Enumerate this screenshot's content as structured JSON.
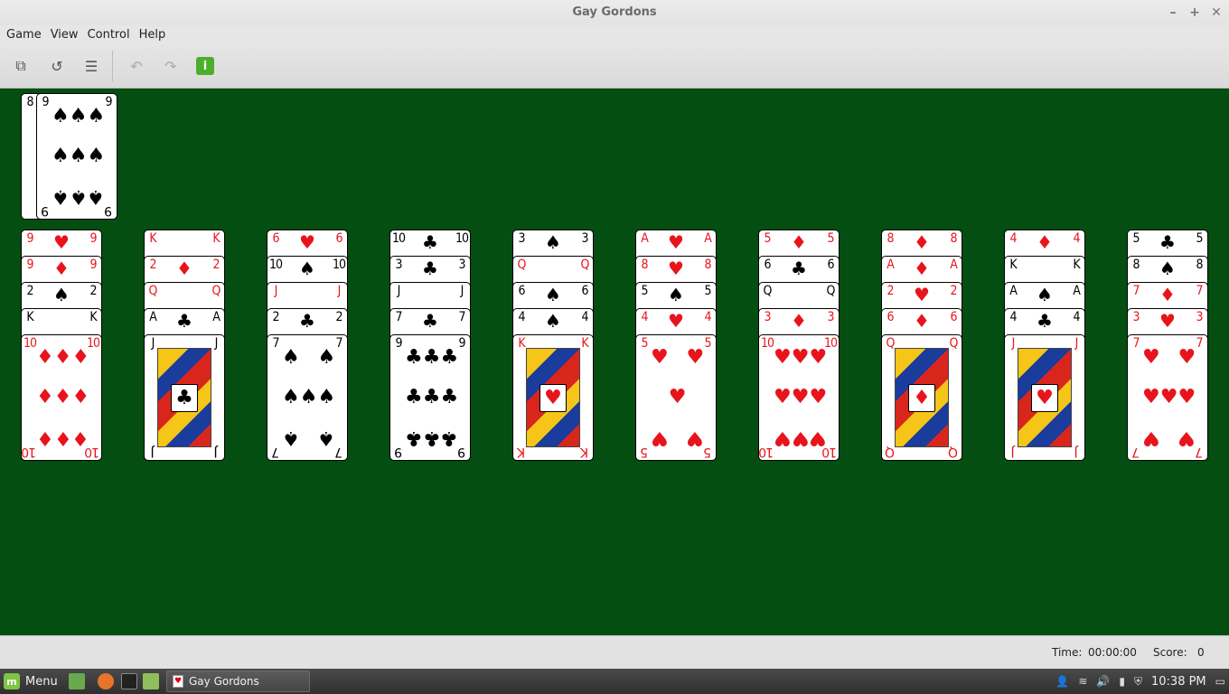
{
  "window": {
    "title": "Gay Gordons",
    "controls": [
      "–",
      "+",
      "✕"
    ]
  },
  "menu": [
    "Game",
    "View",
    "Control",
    "Help"
  ],
  "toolbar": {
    "buttons": [
      {
        "name": "new-game-icon",
        "glyph": "⧉",
        "enabled": true
      },
      {
        "name": "restart-icon",
        "glyph": "↺",
        "enabled": true
      },
      {
        "name": "statistics-icon",
        "glyph": "☰",
        "enabled": true
      },
      {
        "name": "undo-icon",
        "glyph": "↶",
        "enabled": false
      },
      {
        "name": "redo-icon",
        "glyph": "↷",
        "enabled": false
      },
      {
        "name": "info-icon",
        "glyph": "i",
        "enabled": true
      }
    ]
  },
  "reserve": [
    {
      "rank": "8",
      "suit": "clubs"
    },
    {
      "rank": "9",
      "suit": "spades"
    }
  ],
  "tableau": [
    [
      {
        "rank": "9",
        "suit": "hearts"
      },
      {
        "rank": "9",
        "suit": "diamonds"
      },
      {
        "rank": "2",
        "suit": "spades"
      },
      {
        "rank": "K",
        "suit": "spades"
      },
      {
        "rank": "10",
        "suit": "diamonds"
      }
    ],
    [
      {
        "rank": "K",
        "suit": "diamonds"
      },
      {
        "rank": "2",
        "suit": "diamonds"
      },
      {
        "rank": "Q",
        "suit": "diamonds"
      },
      {
        "rank": "A",
        "suit": "clubs"
      },
      {
        "rank": "J",
        "suit": "clubs"
      }
    ],
    [
      {
        "rank": "6",
        "suit": "hearts"
      },
      {
        "rank": "10",
        "suit": "spades"
      },
      {
        "rank": "J",
        "suit": "hearts"
      },
      {
        "rank": "2",
        "suit": "clubs"
      },
      {
        "rank": "7",
        "suit": "spades"
      }
    ],
    [
      {
        "rank": "10",
        "suit": "clubs"
      },
      {
        "rank": "3",
        "suit": "clubs"
      },
      {
        "rank": "J",
        "suit": "spades"
      },
      {
        "rank": "7",
        "suit": "clubs"
      },
      {
        "rank": "9",
        "suit": "clubs"
      }
    ],
    [
      {
        "rank": "3",
        "suit": "spades"
      },
      {
        "rank": "Q",
        "suit": "hearts"
      },
      {
        "rank": "6",
        "suit": "spades"
      },
      {
        "rank": "4",
        "suit": "spades"
      },
      {
        "rank": "K",
        "suit": "hearts"
      }
    ],
    [
      {
        "rank": "A",
        "suit": "hearts"
      },
      {
        "rank": "8",
        "suit": "hearts"
      },
      {
        "rank": "5",
        "suit": "spades"
      },
      {
        "rank": "4",
        "suit": "hearts"
      },
      {
        "rank": "5",
        "suit": "hearts"
      }
    ],
    [
      {
        "rank": "5",
        "suit": "diamonds"
      },
      {
        "rank": "6",
        "suit": "clubs"
      },
      {
        "rank": "Q",
        "suit": "clubs"
      },
      {
        "rank": "3",
        "suit": "diamonds"
      },
      {
        "rank": "10",
        "suit": "hearts"
      }
    ],
    [
      {
        "rank": "8",
        "suit": "diamonds"
      },
      {
        "rank": "A",
        "suit": "diamonds"
      },
      {
        "rank": "2",
        "suit": "hearts"
      },
      {
        "rank": "6",
        "suit": "diamonds"
      },
      {
        "rank": "Q",
        "suit": "diamonds"
      }
    ],
    [
      {
        "rank": "4",
        "suit": "diamonds"
      },
      {
        "rank": "K",
        "suit": "clubs"
      },
      {
        "rank": "A",
        "suit": "spades"
      },
      {
        "rank": "4",
        "suit": "clubs"
      },
      {
        "rank": "J",
        "suit": "hearts"
      }
    ],
    [
      {
        "rank": "5",
        "suit": "clubs"
      },
      {
        "rank": "8",
        "suit": "spades"
      },
      {
        "rank": "7",
        "suit": "diamonds"
      },
      {
        "rank": "3",
        "suit": "hearts"
      },
      {
        "rank": "7",
        "suit": "hearts"
      }
    ]
  ],
  "status": {
    "time_label": "Time:",
    "time_value": "00:00:00",
    "score_label": "Score:",
    "score_value": "0"
  },
  "taskbar": {
    "menu_label": "Menu",
    "window_label": "Gay Gordons",
    "clock": "10:38 PM"
  },
  "colors": {
    "felt": "#044e12",
    "red_suit": "#e8141c",
    "black_suit": "#000000"
  }
}
